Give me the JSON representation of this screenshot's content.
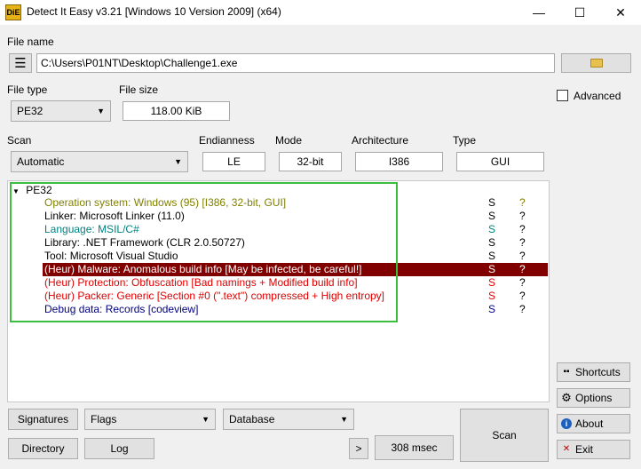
{
  "window": {
    "title": "Detect It Easy v3.21 [Windows 10 Version 2009] (x64)",
    "icon_text": "DiE",
    "min_glyph": "—",
    "max_glyph": "☐",
    "close_glyph": "✕"
  },
  "file_name": {
    "label": "File name",
    "path": "C:\\Users\\P01NT\\Desktop\\Challenge1.exe"
  },
  "file_type": {
    "label": "File type",
    "value": "PE32"
  },
  "file_size": {
    "label": "File size",
    "value": "118.00 KiB"
  },
  "advanced": {
    "label": "Advanced",
    "checked": false
  },
  "scan_mode": {
    "label": "Scan",
    "value": "Automatic"
  },
  "endianness": {
    "label": "Endianness",
    "value": "LE"
  },
  "mode": {
    "label": "Mode",
    "value": "32-bit"
  },
  "architecture": {
    "label": "Architecture",
    "value": "I386"
  },
  "type": {
    "label": "Type",
    "value": "GUI"
  },
  "results": {
    "root": "PE32",
    "rows": [
      {
        "prefix": "Operation system: ",
        "text": "Windows (95) [I386, 32-bit, GUI]",
        "s": "S",
        "q": "?",
        "prefix_color": "#808000",
        "text_color": "#808000",
        "s_color": "#000000",
        "q_color": "#808000"
      },
      {
        "prefix": "Linker: ",
        "text": "Microsoft Linker (11.0)",
        "s": "S",
        "q": "?",
        "prefix_color": "#000000",
        "text_color": "#000000",
        "s_color": "#000000",
        "q_color": "#000000"
      },
      {
        "prefix": "Language: ",
        "text": "MSIL/C#",
        "s": "S",
        "q": "?",
        "prefix_color": "#008080",
        "text_color": "#008080",
        "s_color": "#008080",
        "q_color": "#000000"
      },
      {
        "prefix": "Library: ",
        "text": ".NET Framework (CLR 2.0.50727)",
        "s": "S",
        "q": "?",
        "prefix_color": "#000000",
        "text_color": "#000000",
        "s_color": "#000000",
        "q_color": "#000000"
      },
      {
        "prefix": "Tool: ",
        "text": "Microsoft Visual Studio",
        "s": "S",
        "q": "?",
        "prefix_color": "#000000",
        "text_color": "#000000",
        "s_color": "#000000",
        "q_color": "#000000"
      },
      {
        "prefix": "(Heur) Malware: ",
        "text": "Anomalous build info [May be infected, be careful!]",
        "s": "S",
        "q": "?",
        "prefix_color": "#ffffff",
        "text_color": "#ffffff",
        "s_color": "#ffffff",
        "q_color": "#ffffff"
      },
      {
        "prefix": "(Heur) Protection: ",
        "text": "Obfuscation [Bad namings + Modified build info]",
        "s": "S",
        "q": "?",
        "prefix_color": "#e00000",
        "text_color": "#e00000",
        "s_color": "#e00000",
        "q_color": "#000000"
      },
      {
        "prefix": "(Heur) Packer: ",
        "text": "Generic [Section #0 (\".text\") compressed + High entropy]",
        "s": "S",
        "q": "?",
        "prefix_color": "#e00000",
        "text_color": "#e00000",
        "s_color": "#e00000",
        "q_color": "#000000"
      },
      {
        "prefix": "Debug data: ",
        "text": "Records [codeview]",
        "s": "S",
        "q": "?",
        "prefix_color": "#000080",
        "text_color": "#000080",
        "s_color": "#000080",
        "q_color": "#000000"
      }
    ]
  },
  "right_buttons": {
    "shortcuts": "Shortcuts",
    "options": "Options",
    "about": "About",
    "exit": "Exit"
  },
  "bottom": {
    "signatures": "Signatures",
    "flags": "Flags",
    "database": "Database",
    "directory": "Directory",
    "log": "Log",
    "more": ">",
    "time": "308 msec",
    "scan": "Scan"
  },
  "colors": {
    "highlight": "#800000",
    "selection_box": "#3cbf3c"
  }
}
